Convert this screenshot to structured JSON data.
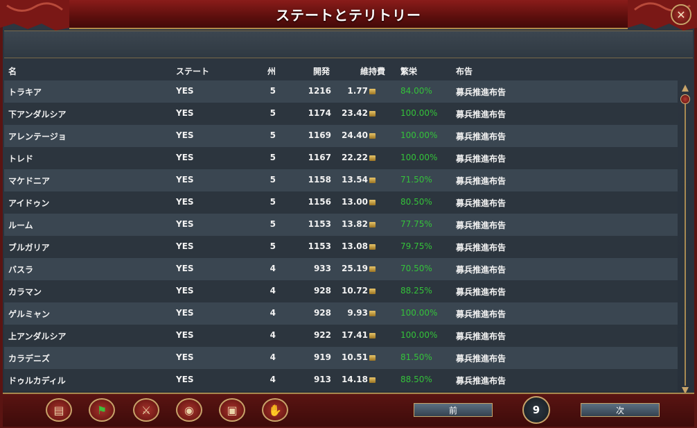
{
  "window": {
    "title": "ステートとテリトリー",
    "close_icon": "close-icon"
  },
  "columns": {
    "name": "名",
    "state": "ステート",
    "provinces": "州",
    "development": "開発",
    "upkeep": "維持費",
    "prosperity": "繁栄",
    "edict": "布告"
  },
  "rows": [
    {
      "name": "トラキア",
      "state": "YES",
      "provinces": "5",
      "development": "1216",
      "upkeep": "1.77",
      "prosperity": "84.00%",
      "edict": "募兵推進布告"
    },
    {
      "name": "下アンダルシア",
      "state": "YES",
      "provinces": "5",
      "development": "1174",
      "upkeep": "23.42",
      "prosperity": "100.00%",
      "edict": "募兵推進布告"
    },
    {
      "name": "アレンテージョ",
      "state": "YES",
      "provinces": "5",
      "development": "1169",
      "upkeep": "24.40",
      "prosperity": "100.00%",
      "edict": "募兵推進布告"
    },
    {
      "name": "トレド",
      "state": "YES",
      "provinces": "5",
      "development": "1167",
      "upkeep": "22.22",
      "prosperity": "100.00%",
      "edict": "募兵推進布告"
    },
    {
      "name": "マケドニア",
      "state": "YES",
      "provinces": "5",
      "development": "1158",
      "upkeep": "13.54",
      "prosperity": "71.50%",
      "edict": "募兵推進布告"
    },
    {
      "name": "アイドゥン",
      "state": "YES",
      "provinces": "5",
      "development": "1156",
      "upkeep": "13.00",
      "prosperity": "80.50%",
      "edict": "募兵推進布告"
    },
    {
      "name": "ルーム",
      "state": "YES",
      "provinces": "5",
      "development": "1153",
      "upkeep": "13.82",
      "prosperity": "77.75%",
      "edict": "募兵推進布告"
    },
    {
      "name": "ブルガリア",
      "state": "YES",
      "provinces": "5",
      "development": "1153",
      "upkeep": "13.08",
      "prosperity": "79.75%",
      "edict": "募兵推進布告"
    },
    {
      "name": "バスラ",
      "state": "YES",
      "provinces": "4",
      "development": "933",
      "upkeep": "25.19",
      "prosperity": "70.50%",
      "edict": "募兵推進布告"
    },
    {
      "name": "カラマン",
      "state": "YES",
      "provinces": "4",
      "development": "928",
      "upkeep": "10.72",
      "prosperity": "88.25%",
      "edict": "募兵推進布告"
    },
    {
      "name": "ゲルミャン",
      "state": "YES",
      "provinces": "4",
      "development": "928",
      "upkeep": "9.93",
      "prosperity": "100.00%",
      "edict": "募兵推進布告"
    },
    {
      "name": "上アンダルシア",
      "state": "YES",
      "provinces": "4",
      "development": "922",
      "upkeep": "17.41",
      "prosperity": "100.00%",
      "edict": "募兵推進布告"
    },
    {
      "name": "カラデニズ",
      "state": "YES",
      "provinces": "4",
      "development": "919",
      "upkeep": "10.51",
      "prosperity": "81.50%",
      "edict": "募兵推進布告"
    },
    {
      "name": "ドゥルカディル",
      "state": "YES",
      "provinces": "4",
      "development": "913",
      "upkeep": "14.18",
      "prosperity": "88.50%",
      "edict": "募兵推進布告"
    }
  ],
  "toolbar": {
    "icons": [
      "scroll-icon",
      "flag-icon",
      "crossed-swords-icon",
      "coins-icon",
      "crate-icon",
      "handshake-icon"
    ]
  },
  "pagination": {
    "prev_label": "前",
    "next_label": "次",
    "page": "9"
  },
  "colors": {
    "prosperity": "#34c23a",
    "frame": "#5a1412",
    "gold": "#c8a46a"
  }
}
